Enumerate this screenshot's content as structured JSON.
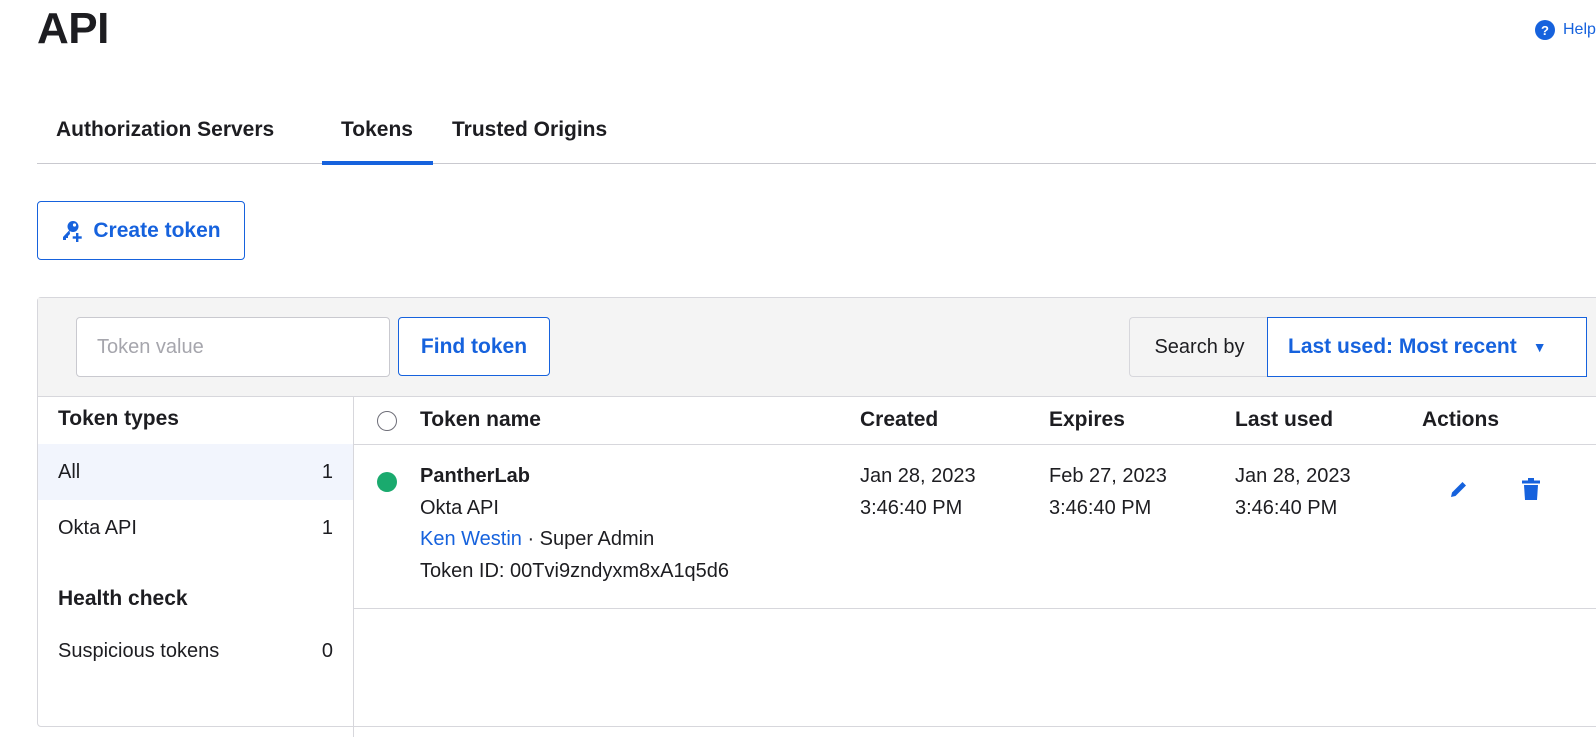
{
  "page": {
    "title": "API",
    "help_label": "Help"
  },
  "tabs": [
    {
      "label": "Authorization Servers"
    },
    {
      "label": "Tokens"
    },
    {
      "label": "Trusted Origins"
    }
  ],
  "create_button": {
    "label": "Create token",
    "icon": "key-plus-icon"
  },
  "toolbar": {
    "token_input_placeholder": "Token value",
    "find_label": "Find token",
    "search_by_label": "Search by",
    "sort_value": "Last used: Most recent",
    "sort_caret": "▼"
  },
  "sidebar": {
    "token_types_heading": "Token types",
    "token_types": [
      {
        "label": "All",
        "count": "1"
      },
      {
        "label": "Okta API",
        "count": "1"
      }
    ],
    "health_heading": "Health check",
    "health_items": [
      {
        "label": "Suspicious tokens",
        "count": "0"
      }
    ]
  },
  "table": {
    "headers": {
      "name": "Token name",
      "created": "Created",
      "expires": "Expires",
      "last_used": "Last used",
      "actions": "Actions"
    },
    "rows": [
      {
        "status_color": "#1aaa6e",
        "name": "PantherLab",
        "type": "Okta API",
        "owner": "Ken Westin",
        "role_separator": " · Super Admin",
        "token_id": "Token ID: 00Tvi9zndyxm8xA1q5d6",
        "created_date": "Jan 28, 2023",
        "created_time": "3:46:40 PM",
        "expires_date": "Feb 27, 2023",
        "expires_time": "3:46:40 PM",
        "last_used_date": "Jan 28, 2023",
        "last_used_time": "3:46:40 PM"
      }
    ]
  },
  "colors": {
    "accent": "#1662dd",
    "status_active": "#1aaa6e"
  }
}
